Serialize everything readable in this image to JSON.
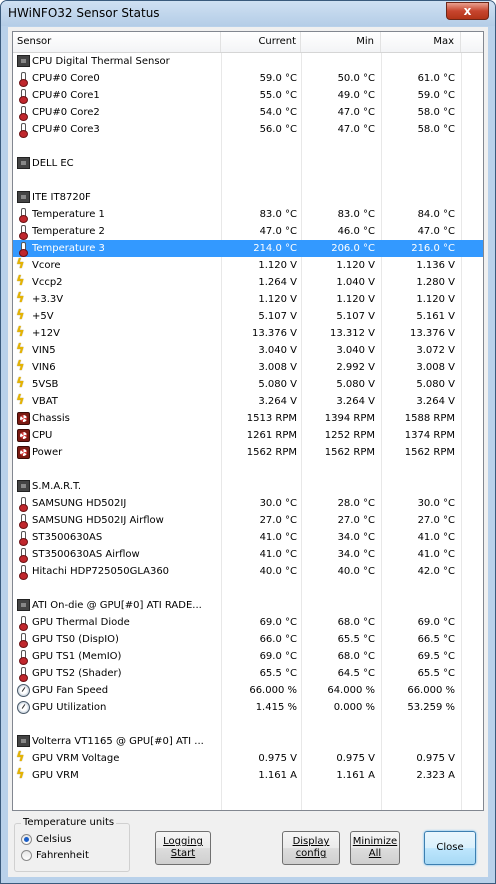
{
  "window": {
    "title": "HWiNFO32 Sensor Status",
    "close_glyph": "x"
  },
  "columns": {
    "sensor": "Sensor",
    "current": "Current",
    "min": "Min",
    "max": "Max"
  },
  "rows": [
    {
      "icon": "chip-icon",
      "cls": "chip",
      "name": "CPU Digital Thermal Sensor",
      "current": "",
      "min": "",
      "max": ""
    },
    {
      "icon": "thermometer-icon",
      "cls": "thermo",
      "name": "CPU#0 Core0",
      "current": "59.0 °C",
      "min": "50.0 °C",
      "max": "61.0 °C"
    },
    {
      "icon": "thermometer-icon",
      "cls": "thermo",
      "name": "CPU#0 Core1",
      "current": "55.0 °C",
      "min": "49.0 °C",
      "max": "59.0 °C"
    },
    {
      "icon": "thermometer-icon",
      "cls": "thermo",
      "name": "CPU#0 Core2",
      "current": "54.0 °C",
      "min": "47.0 °C",
      "max": "58.0 °C"
    },
    {
      "icon": "thermometer-icon",
      "cls": "thermo",
      "name": "CPU#0 Core3",
      "current": "56.0 °C",
      "min": "47.0 °C",
      "max": "58.0 °C"
    },
    {
      "icon": "",
      "cls": "",
      "name": "",
      "current": "",
      "min": "",
      "max": ""
    },
    {
      "icon": "chip-icon",
      "cls": "chip",
      "name": "DELL EC",
      "current": "",
      "min": "",
      "max": ""
    },
    {
      "icon": "",
      "cls": "",
      "name": "",
      "current": "",
      "min": "",
      "max": ""
    },
    {
      "icon": "chip-icon",
      "cls": "chip",
      "name": "ITE IT8720F",
      "current": "",
      "min": "",
      "max": ""
    },
    {
      "icon": "thermometer-icon",
      "cls": "thermo",
      "name": "Temperature 1",
      "current": "83.0 °C",
      "min": "83.0 °C",
      "max": "84.0 °C"
    },
    {
      "icon": "thermometer-icon",
      "cls": "thermo",
      "name": "Temperature 2",
      "current": "47.0 °C",
      "min": "46.0 °C",
      "max": "47.0 °C"
    },
    {
      "icon": "thermometer-icon",
      "cls": "thermo",
      "name": "Temperature 3",
      "current": "214.0 °C",
      "min": "206.0 °C",
      "max": "216.0 °C",
      "selected": true
    },
    {
      "icon": "voltage-bolt-icon",
      "cls": "bolt",
      "name": "Vcore",
      "current": "1.120 V",
      "min": "1.120 V",
      "max": "1.136 V"
    },
    {
      "icon": "voltage-bolt-icon",
      "cls": "bolt",
      "name": "Vccp2",
      "current": "1.264 V",
      "min": "1.040 V",
      "max": "1.280 V"
    },
    {
      "icon": "voltage-bolt-icon",
      "cls": "bolt",
      "name": "+3.3V",
      "current": "1.120 V",
      "min": "1.120 V",
      "max": "1.120 V"
    },
    {
      "icon": "voltage-bolt-icon",
      "cls": "bolt",
      "name": "+5V",
      "current": "5.107 V",
      "min": "5.107 V",
      "max": "5.161 V"
    },
    {
      "icon": "voltage-bolt-icon",
      "cls": "bolt",
      "name": "+12V",
      "current": "13.376 V",
      "min": "13.312 V",
      "max": "13.376 V"
    },
    {
      "icon": "voltage-bolt-icon",
      "cls": "bolt",
      "name": "VIN5",
      "current": "3.040 V",
      "min": "3.040 V",
      "max": "3.072 V"
    },
    {
      "icon": "voltage-bolt-icon",
      "cls": "bolt",
      "name": "VIN6",
      "current": "3.008 V",
      "min": "2.992 V",
      "max": "3.008 V"
    },
    {
      "icon": "voltage-bolt-icon",
      "cls": "bolt",
      "name": "5VSB",
      "current": "5.080 V",
      "min": "5.080 V",
      "max": "5.080 V"
    },
    {
      "icon": "voltage-bolt-icon",
      "cls": "bolt",
      "name": "VBAT",
      "current": "3.264 V",
      "min": "3.264 V",
      "max": "3.264 V"
    },
    {
      "icon": "fan-icon",
      "cls": "fan",
      "name": "Chassis",
      "current": "1513 RPM",
      "min": "1394 RPM",
      "max": "1588 RPM"
    },
    {
      "icon": "fan-icon",
      "cls": "fan",
      "name": "CPU",
      "current": "1261 RPM",
      "min": "1252 RPM",
      "max": "1374 RPM"
    },
    {
      "icon": "fan-icon",
      "cls": "fan",
      "name": "Power",
      "current": "1562 RPM",
      "min": "1562 RPM",
      "max": "1562 RPM"
    },
    {
      "icon": "",
      "cls": "",
      "name": "",
      "current": "",
      "min": "",
      "max": ""
    },
    {
      "icon": "chip-icon",
      "cls": "chip",
      "name": "S.M.A.R.T.",
      "current": "",
      "min": "",
      "max": ""
    },
    {
      "icon": "thermometer-icon",
      "cls": "thermo",
      "name": "SAMSUNG HD502IJ",
      "current": "30.0 °C",
      "min": "28.0 °C",
      "max": "30.0 °C"
    },
    {
      "icon": "thermometer-icon",
      "cls": "thermo",
      "name": "SAMSUNG HD502IJ Airflow",
      "current": "27.0 °C",
      "min": "27.0 °C",
      "max": "27.0 °C"
    },
    {
      "icon": "thermometer-icon",
      "cls": "thermo",
      "name": "ST3500630AS",
      "current": "41.0 °C",
      "min": "34.0 °C",
      "max": "41.0 °C"
    },
    {
      "icon": "thermometer-icon",
      "cls": "thermo",
      "name": "ST3500630AS Airflow",
      "current": "41.0 °C",
      "min": "34.0 °C",
      "max": "41.0 °C"
    },
    {
      "icon": "thermometer-icon",
      "cls": "thermo",
      "name": "Hitachi HDP725050GLA360",
      "current": "40.0 °C",
      "min": "40.0 °C",
      "max": "42.0 °C"
    },
    {
      "icon": "",
      "cls": "",
      "name": "",
      "current": "",
      "min": "",
      "max": ""
    },
    {
      "icon": "chip-icon",
      "cls": "chip",
      "name": "ATI On-die @ GPU[#0] ATI RADE...",
      "current": "",
      "min": "",
      "max": ""
    },
    {
      "icon": "thermometer-icon",
      "cls": "thermo",
      "name": "GPU Thermal Diode",
      "current": "69.0 °C",
      "min": "68.0 °C",
      "max": "69.0 °C"
    },
    {
      "icon": "thermometer-icon",
      "cls": "thermo",
      "name": "GPU TS0 (DispIO)",
      "current": "66.0 °C",
      "min": "65.5 °C",
      "max": "66.5 °C"
    },
    {
      "icon": "thermometer-icon",
      "cls": "thermo",
      "name": "GPU TS1 (MemIO)",
      "current": "69.0 °C",
      "min": "68.0 °C",
      "max": "69.5 °C"
    },
    {
      "icon": "thermometer-icon",
      "cls": "thermo",
      "name": "GPU TS2 (Shader)",
      "current": "65.5 °C",
      "min": "64.5 °C",
      "max": "65.5 °C"
    },
    {
      "icon": "gauge-icon",
      "cls": "gauge",
      "name": "GPU Fan Speed",
      "current": "66.000 %",
      "min": "64.000 %",
      "max": "66.000 %"
    },
    {
      "icon": "gauge-icon",
      "cls": "gauge",
      "name": "GPU Utilization",
      "current": "1.415 %",
      "min": "0.000 %",
      "max": "53.259 %"
    },
    {
      "icon": "",
      "cls": "",
      "name": "",
      "current": "",
      "min": "",
      "max": ""
    },
    {
      "icon": "chip-icon",
      "cls": "chip",
      "name": "Volterra VT1165 @ GPU[#0] ATI ...",
      "current": "",
      "min": "",
      "max": ""
    },
    {
      "icon": "voltage-bolt-icon",
      "cls": "bolt",
      "name": "GPU VRM Voltage",
      "current": "0.975 V",
      "min": "0.975 V",
      "max": "0.975 V"
    },
    {
      "icon": "voltage-bolt-icon",
      "cls": "bolt",
      "name": "GPU VRM",
      "current": "1.161 A",
      "min": "1.161 A",
      "max": "2.323 A"
    }
  ],
  "units": {
    "title": "Temperature units",
    "celsius": "Celsius",
    "fahrenheit": "Fahrenheit",
    "selected": "Celsius"
  },
  "buttons": {
    "logging_line1": "Logging",
    "logging_line2": "Start",
    "display_line1": "Display",
    "display_line2": "config",
    "minimize_line1": "Minimize",
    "minimize_line2": "All",
    "close": "Close"
  }
}
